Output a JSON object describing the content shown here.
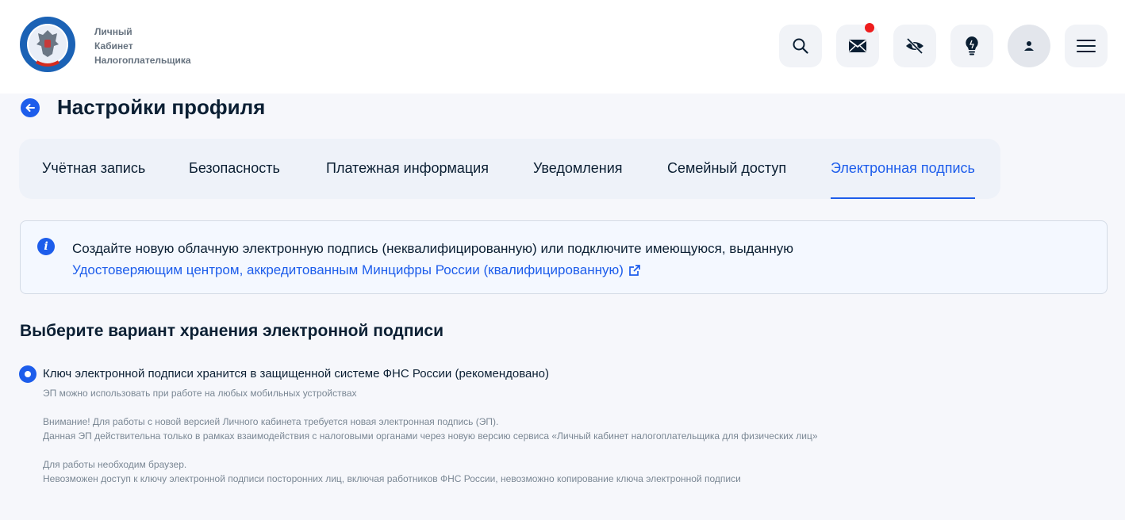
{
  "header": {
    "app_title_lines": [
      "Личный",
      "Кабинет",
      "Налогоплательщика"
    ],
    "icons": [
      "search-icon",
      "mail-icon",
      "eye-off-icon",
      "lightbulb-icon",
      "user-icon",
      "menu-icon"
    ],
    "notification_dot_color": "#ee1d1d"
  },
  "page": {
    "title": "Настройки профиля"
  },
  "tabs": [
    {
      "label": "Учётная запись",
      "active": false
    },
    {
      "label": "Безопасность",
      "active": false
    },
    {
      "label": "Платежная информация",
      "active": false
    },
    {
      "label": "Уведомления",
      "active": false
    },
    {
      "label": "Семейный доступ",
      "active": false
    },
    {
      "label": "Электронная подпись",
      "active": true
    }
  ],
  "info": {
    "text": "Создайте новую облачную электронную подпись (неквалифицированную) или подключите имеющуюся, выданную",
    "link": "Удостоверяющим центром, аккредитованным Минцифры России (квалифицированную)"
  },
  "storage": {
    "title": "Выберите вариант хранения электронной подписи",
    "option_label": "Ключ электронной подписи хранится в защищенной системе ФНС России (рекомендовано)",
    "option_selected": true,
    "hints": [
      "ЭП можно использовать при работе на любых мобильных устройствах",
      "Внимание! Для работы с новой версией Личного кабинета требуется новая электронная подпись (ЭП).",
      "Данная ЭП действительна только в рамках взаимодействия с налоговыми органами через новую версию сервиса «Личный кабинет налогоплательщика для физических лиц»",
      "Для работы необходим браузер.",
      "Невозможен доступ к ключу электронной подписи посторонних лиц, включая работников ФНС России, невозможно копирование ключа электронной подписи"
    ]
  },
  "colors": {
    "accent": "#1d5deb",
    "text": "#0b1f33",
    "muted": "#7a8794"
  }
}
